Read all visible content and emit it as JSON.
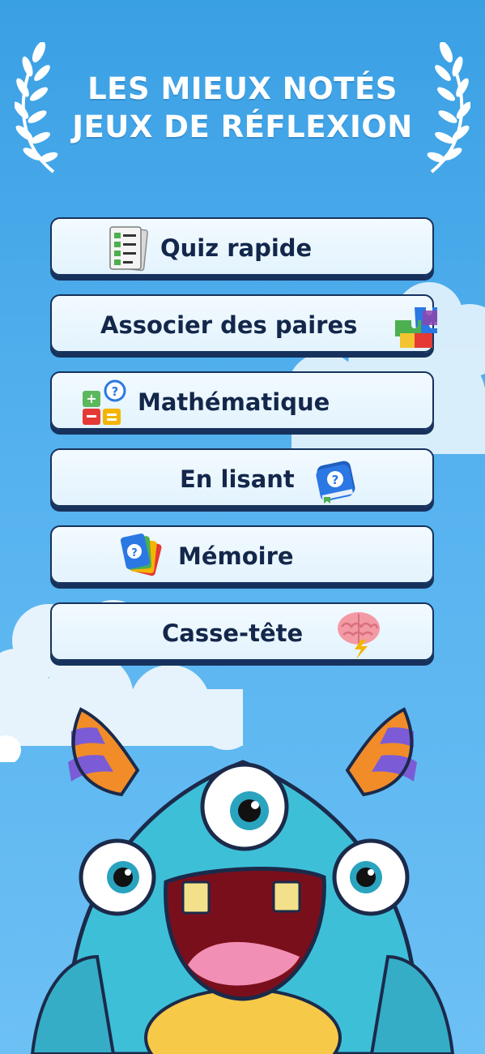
{
  "header": {
    "title_line1": "LES MIEUX NOTÉS",
    "title_line2": "JEUX DE RÉFLEXION",
    "laurel_icon": "laurel-icon"
  },
  "menu": {
    "items": [
      {
        "label": "Quiz rapide",
        "icon": "checklist-icon"
      },
      {
        "label": "Associer des paires",
        "icon": "puzzle-icon"
      },
      {
        "label": "Mathématique",
        "icon": "math-blocks-icon"
      },
      {
        "label": "En lisant",
        "icon": "book-icon"
      },
      {
        "label": "Mémoire",
        "icon": "cards-icon"
      },
      {
        "label": "Casse-tête",
        "icon": "brain-icon"
      }
    ]
  },
  "mascot": {
    "name": "monster-mascot",
    "color": "#3ebfd8"
  },
  "colors": {
    "sky": "#3aa0e4",
    "button_border": "#16325c",
    "button_text": "#13274b"
  }
}
